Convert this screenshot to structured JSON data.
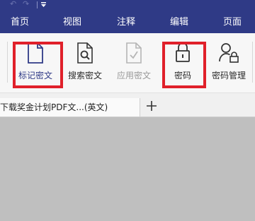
{
  "titlebar": {
    "undo_glyph": "↶",
    "redo_glyph": "↷"
  },
  "menu": {
    "items": [
      {
        "label": "首页"
      },
      {
        "label": "视图"
      },
      {
        "label": "注释"
      },
      {
        "label": "编辑"
      },
      {
        "label": "页面"
      }
    ]
  },
  "ribbon": {
    "tools": [
      {
        "label": "标记密文",
        "icon": "document-icon",
        "state": "active",
        "highlighted": true
      },
      {
        "label": "搜索密文",
        "icon": "document-search-icon",
        "state": "normal",
        "highlighted": false
      },
      {
        "label": "应用密文",
        "icon": "document-check-icon",
        "state": "disabled",
        "highlighted": false
      },
      {
        "label": "密码",
        "icon": "lock-icon",
        "state": "normal",
        "highlighted": true
      },
      {
        "label": "密码管理",
        "icon": "user-lock-icon",
        "state": "normal",
        "highlighted": false
      }
    ]
  },
  "tabs": {
    "document_title": "下载奖金计划PDF文...(英文)",
    "close_glyph": "×",
    "new_tab_icon": "plus-icon"
  },
  "colors": {
    "brand_bar": "#2f3a86",
    "highlight_red": "#e0202a",
    "canvas_gray": "#bfbfbf"
  }
}
